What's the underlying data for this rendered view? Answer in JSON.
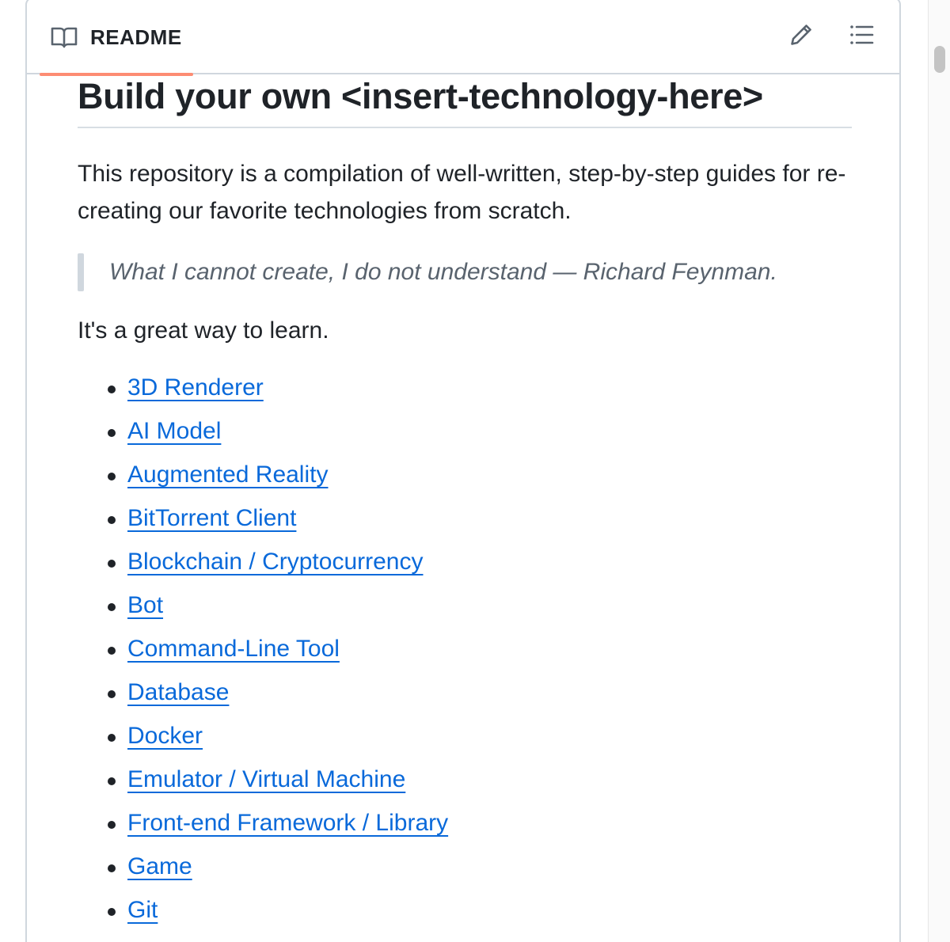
{
  "header": {
    "tab_label": "README",
    "tab_icon": "book-icon",
    "edit_icon": "pencil-icon",
    "outline_icon": "list-unordered-icon",
    "accent_color": "#fd8c73"
  },
  "readme": {
    "title": "Build your own <insert-technology-here>",
    "intro": "This repository is a compilation of well-written, step-by-step guides for re-creating our favorite technologies from scratch.",
    "quote": "What I cannot create, I do not understand — Richard Feynman.",
    "learn": "It's a great way to learn.",
    "link_color": "#0969da",
    "links": [
      "3D Renderer",
      "AI Model",
      "Augmented Reality",
      "BitTorrent Client",
      "Blockchain / Cryptocurrency",
      "Bot",
      "Command-Line Tool",
      "Database",
      "Docker",
      "Emulator / Virtual Machine",
      "Front-end Framework / Library",
      "Game",
      "Git"
    ]
  }
}
